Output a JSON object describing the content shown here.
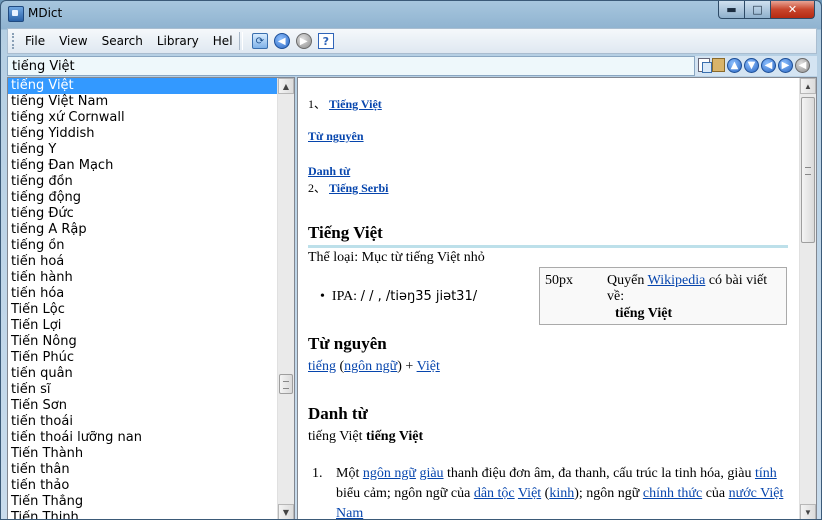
{
  "window": {
    "title": "MDict",
    "min_icon": "minimize-icon",
    "max_icon": "maximize-icon",
    "close_icon": "close-icon"
  },
  "menu": [
    "File",
    "View",
    "Search",
    "Library",
    "Help"
  ],
  "toolbar_icons": [
    "sync-icon",
    "back-icon",
    "forward-icon",
    "help-icon"
  ],
  "search": {
    "value": "tiếng Việt"
  },
  "nav_icons": [
    "copy-icon",
    "paste-icon",
    "arrow-up-icon",
    "arrow-down-icon",
    "arrow-left-icon",
    "arrow-right-icon",
    "arrow-back-icon"
  ],
  "word_list": [
    "tiếng Việt",
    "tiếng Việt Nam",
    "tiếng xứ Cornwall",
    "tiếng Yiddish",
    "tiếng Ý",
    "tiếng Đan Mạch",
    "tiếng đồn",
    "tiếng động",
    "tiếng Đức",
    "tiếng Ả Rập",
    "tiếng ồn",
    "tiến hoá",
    "tiến hành",
    "tiến hóa",
    "Tiến Lộc",
    "Tiến Lợi",
    "Tiến Nông",
    "Tiến Phúc",
    "tiến quân",
    "tiến sĩ",
    "Tiến Sơn",
    "tiến thoái",
    "tiến thoái lưỡng nan",
    "Tiến Thành",
    "tiến thân",
    "tiến thảo",
    "Tiến Thắng",
    "Tiến Thịnh"
  ],
  "selected_index": 0,
  "article": {
    "toc1_num": "1、",
    "toc1_link": "Tiếng Việt",
    "toc_etym": "Từ nguyên",
    "toc_noun": "Danh từ",
    "toc2_num": "2、",
    "toc2_link": "Tiếng Serbi",
    "heading1": "Tiếng Việt",
    "category": "Thể loại: Mục từ tiếng Việt nhỏ",
    "ipa_label": "IPA:",
    "ipa_value": "/ / , /tiəŋ35 jiət31/",
    "infobox_size": "50px",
    "infobox_pre": "Quyển",
    "infobox_link": "Wikipedia",
    "infobox_post": "có bài viết về:",
    "infobox_title": "tiếng Việt",
    "heading_etym": "Từ nguyên",
    "etym_link1": "tiếng",
    "etym_paren_open": "(",
    "etym_link2": "ngôn ngữ",
    "etym_paren_close": ") +",
    "etym_link3": "Việt",
    "heading_noun": "Danh từ",
    "noun_plain": "tiếng Việt",
    "noun_bold": "tiếng Việt",
    "def_num": "1.",
    "def_1": "Một",
    "def_l1": "ngôn ngữ",
    "def_l2": "giàu",
    "def_2": "thanh điệu đơn âm, đa thanh, cấu trúc la tinh hóa, giàu",
    "def_l3": "tính",
    "def_3": "biểu cảm; ngôn ngữ của",
    "def_l4": "dân tộc",
    "def_l5": "Việt",
    "def_l6": "kinh",
    "def_4": "; ngôn ngữ",
    "def_l7": "chính thức",
    "def_5": "của",
    "def_l8": "nước Việt Nam"
  }
}
